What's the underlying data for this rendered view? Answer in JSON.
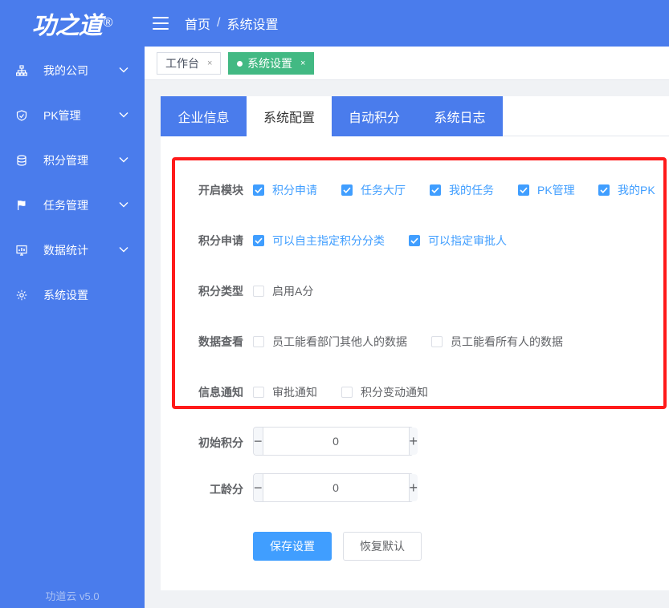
{
  "app": {
    "logo": "功之道",
    "version": "功道云 v5.0"
  },
  "sidebar": {
    "items": [
      {
        "label": "我的公司",
        "icon": "org-chart-icon",
        "has_submenu": true
      },
      {
        "label": "PK管理",
        "icon": "shield-icon",
        "has_submenu": true
      },
      {
        "label": "积分管理",
        "icon": "database-icon",
        "has_submenu": true
      },
      {
        "label": "任务管理",
        "icon": "flag-icon",
        "has_submenu": true
      },
      {
        "label": "数据统计",
        "icon": "chart-monitor-icon",
        "has_submenu": true
      },
      {
        "label": "系统设置",
        "icon": "gear-icon",
        "has_submenu": false
      }
    ]
  },
  "header": {
    "breadcrumb": [
      "首页",
      "系统设置"
    ],
    "separator": "/"
  },
  "tags": [
    {
      "label": "工作台",
      "close": "×",
      "active": false
    },
    {
      "label": "系统设置",
      "close": "×",
      "active": true
    }
  ],
  "tabs": [
    "企业信息",
    "系统配置",
    "自动积分",
    "系统日志"
  ],
  "active_tab": 1,
  "form": {
    "modules": {
      "label": "开启模块",
      "options": [
        {
          "text": "积分申请",
          "checked": true
        },
        {
          "text": "任务大厅",
          "checked": true
        },
        {
          "text": "我的任务",
          "checked": true
        },
        {
          "text": "PK管理",
          "checked": true
        },
        {
          "text": "我的PK",
          "checked": true
        }
      ]
    },
    "apply": {
      "label": "积分申请",
      "options": [
        {
          "text": "可以自主指定积分分类",
          "checked": true
        },
        {
          "text": "可以指定审批人",
          "checked": true
        }
      ]
    },
    "type": {
      "label": "积分类型",
      "options": [
        {
          "text": "启用A分",
          "checked": false
        }
      ]
    },
    "view": {
      "label": "数据查看",
      "options": [
        {
          "text": "员工能看部门其他人的数据",
          "checked": false
        },
        {
          "text": "员工能看所有人的数据",
          "checked": false
        }
      ]
    },
    "notify": {
      "label": "信息通知",
      "options": [
        {
          "text": "审批通知",
          "checked": false
        },
        {
          "text": "积分变动通知",
          "checked": false
        }
      ]
    },
    "initial_points": {
      "label": "初始积分",
      "value": "0",
      "minus": "−",
      "plus": "+"
    },
    "seniority": {
      "label": "工龄分",
      "value": "0",
      "minus": "−",
      "plus": "+"
    }
  },
  "buttons": {
    "save": "保存设置",
    "reset": "恢复默认"
  },
  "colors": {
    "sidebar": "#4a7cec",
    "primary": "#409eff",
    "active_tag": "#42b983",
    "highlight": "#ff1a1a"
  }
}
